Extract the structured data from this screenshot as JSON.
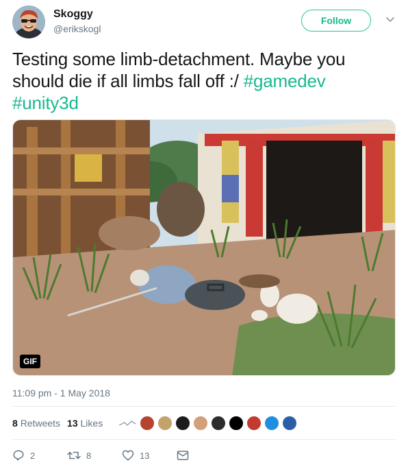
{
  "author": {
    "name": "Skoggy",
    "handle": "@erikskogl",
    "follow_label": "Follow"
  },
  "tweet": {
    "text_plain": "Testing some limb-detachment. Maybe you should die if all limbs fall off :/ ",
    "hashtag1": "#gamedev",
    "hashtag2": "#unity3d",
    "media_badge": "GIF",
    "timestamp": "11:09 pm - 1 May 2018"
  },
  "stats": {
    "retweets_count": "8",
    "retweets_label": "Retweets",
    "likes_count": "13",
    "likes_label": "Likes"
  },
  "actions": {
    "reply_count": "2",
    "retweet_count": "8",
    "like_count": "13"
  },
  "colors": {
    "accent": "#17b890",
    "muted": "#657786",
    "text": "#14171a"
  },
  "icons": [
    "reply-icon",
    "retweet-icon",
    "heart-icon",
    "direct-message-icon",
    "chevron-down-icon"
  ]
}
